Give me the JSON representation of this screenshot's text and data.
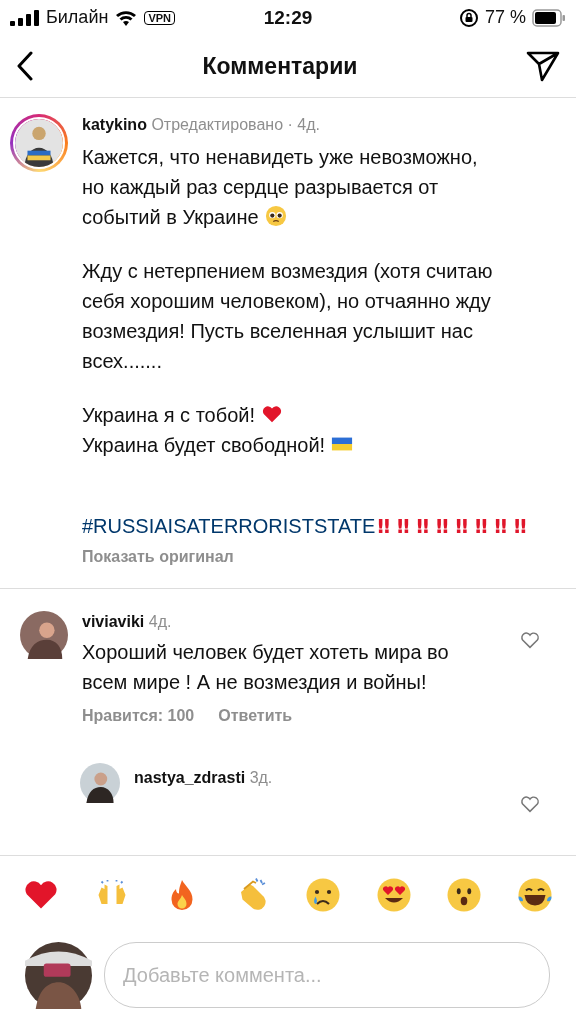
{
  "status_bar": {
    "carrier": "Билайн",
    "vpn": "VPN",
    "time": "12:29",
    "battery": "77 %"
  },
  "header": {
    "title": "Комментарии"
  },
  "post_comment": {
    "username": "katykino",
    "meta": "Отредактировано · 4д.",
    "paragraphs": [
      [
        "Кажется, что ненавидеть уже невозможно,",
        "но каждый раз сердце разрывается от",
        "событий в Украине"
      ],
      [
        "Жду с нетерпением возмездия (хотя считаю",
        "себя хорошим человеком), но отчаянно жду",
        "возмездия! Пусть вселенная услышит нас",
        "всех......."
      ],
      [
        "Украина я с тобой!",
        "Украина будет свободной!"
      ]
    ],
    "hashtag": "#RUSSIAISATERRORISTSTATE",
    "exclamations": "‼ ‼ ‼ ‼ ‼ ‼ ‼ ‼",
    "translate": "Показать оригинал"
  },
  "comments": [
    {
      "username": "viviaviki",
      "time": "4д.",
      "text": "Хороший человек будет хотеть мира во всем мире ! А не возмездия и войны!",
      "likes": "Нравится: 100",
      "reply": "Ответить",
      "liked": false
    }
  ],
  "reply": {
    "username": "nastya_zdrasti",
    "time": "3д.",
    "liked": false
  },
  "composer": {
    "placeholder": "Добавьте коммента..."
  }
}
